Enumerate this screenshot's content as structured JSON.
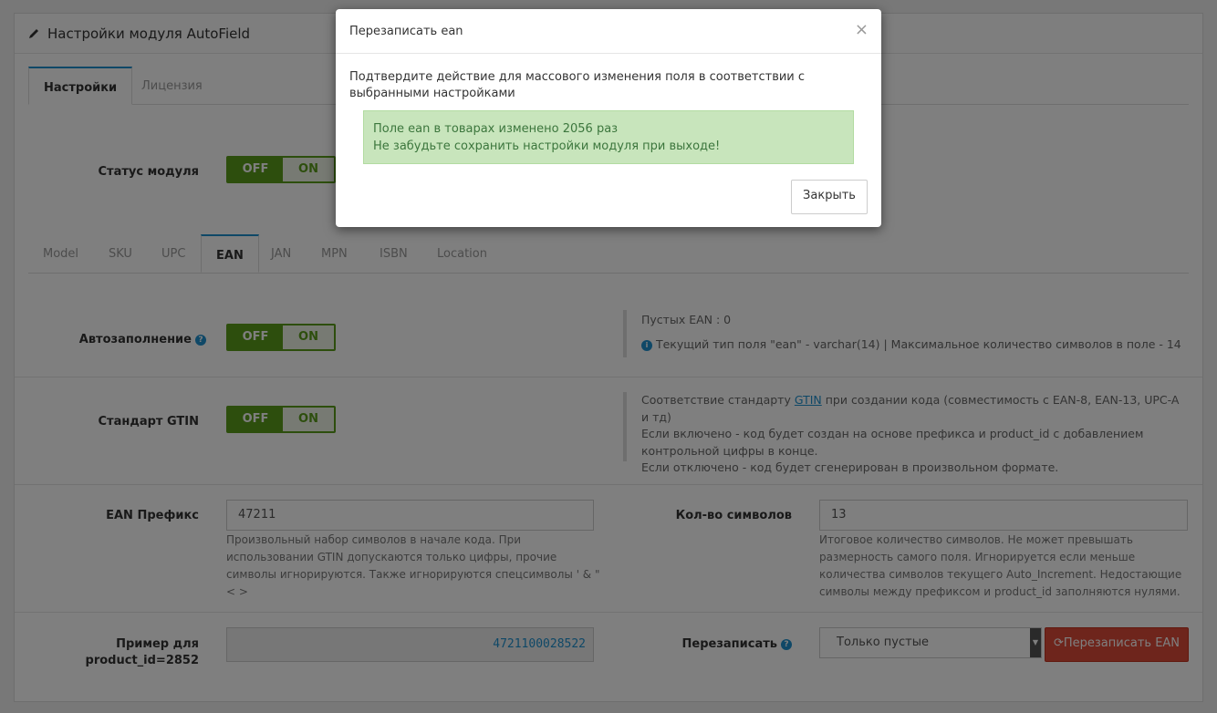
{
  "panel": {
    "title": "Настройки модуля AutoField"
  },
  "top_tabs": [
    "Настройки",
    "Лицензия"
  ],
  "status": {
    "label": "Статус модуля",
    "off": "OFF",
    "on": "ON"
  },
  "ean_tabs": [
    "Model",
    "SKU",
    "UPC",
    "EAN",
    "JAN",
    "MPN",
    "ISBN",
    "Location"
  ],
  "autofill": {
    "label": "Автозаполнение",
    "off": "OFF",
    "on": "ON",
    "empty_count": "Пустых EAN : 0",
    "field_info": "Текущий тип поля \"ean\" - varchar(14) | Максимальное количество символов в поле - 14"
  },
  "gtin": {
    "label": "Стандарт GTIN",
    "off": "OFF",
    "on": "ON",
    "info_prefix": "Соответствие стандарту ",
    "info_link": "GTIN",
    "info_suffix": " при создании кода (совместимость с EAN-8, EAN-13, UPC-A и тд)",
    "info_line2": "Если включено - код будет создан на основе префикса и product_id с добавлением контрольной цифры в конце.",
    "info_line3": "Если отключено - код будет сгенерирован в произвольном формате."
  },
  "prefix": {
    "label": "EAN Префикс",
    "value": "47211",
    "help": "Произвольный набор символов в начале кода. При использовании GTIN допускаются только цифры, прочие символы игнорируются. Также игнорируются спецсимволы ' & \" < >"
  },
  "length": {
    "label": "Кол-во символов",
    "value": "13",
    "help": "Итоговое количество символов. Не может превышать размерность самого поля. Игнорируется если меньше количества символов текущего Auto_Increment. Недостающие символы между префиксом и product_id заполняются нулями."
  },
  "example": {
    "label_line1": "Пример для",
    "label_line2": "product_id=2852",
    "value": "4721100028522"
  },
  "overwrite": {
    "label": "Перезаписать",
    "select_value": "Только пустые",
    "button": "Перезаписать EAN"
  },
  "modal": {
    "title": "Перезаписать ean",
    "text": "Подтвердите действие для массового изменения поля в соответствии с выбранными настройками",
    "alert_line1": "Поле ean в товарах изменено 2056 раз",
    "alert_line2": "Не забудьте сохранить настройки модуля при выходе!",
    "close_button": "Закрыть",
    "close_icon": "×"
  }
}
